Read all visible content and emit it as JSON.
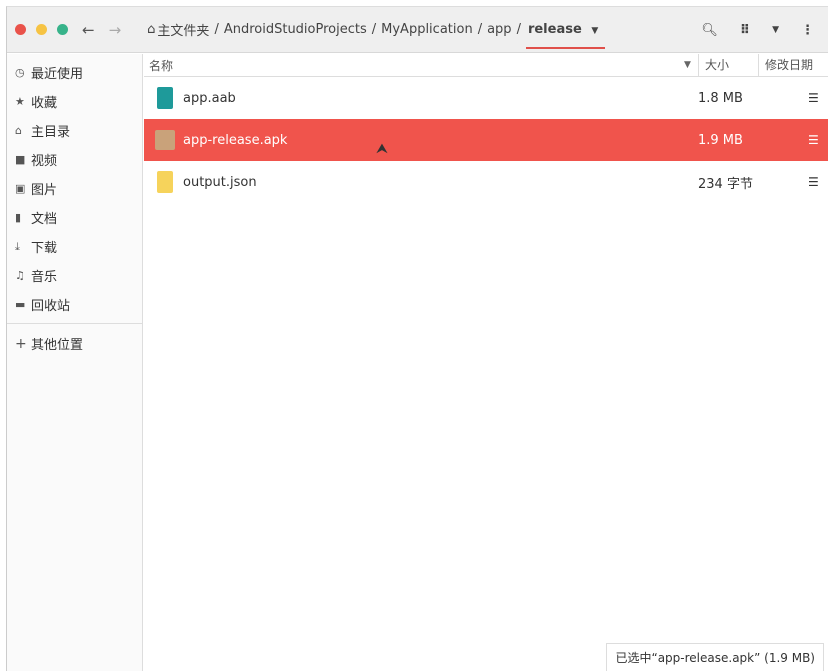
{
  "window": {
    "colors": {
      "close": "#e9524a",
      "minimize": "#f6c343",
      "maximize": "#37b38a",
      "accent": "#f0544c"
    }
  },
  "breadcrumb": {
    "home": "主文件夹",
    "parts": [
      "AndroidStudioProjects",
      "MyApplication",
      "app"
    ],
    "current": "release"
  },
  "sidebar": {
    "items": [
      {
        "icon": "clock-icon",
        "label": "最近使用"
      },
      {
        "icon": "star-icon",
        "label": "收藏"
      },
      {
        "icon": "home-icon",
        "label": "主目录"
      },
      {
        "icon": "video-icon",
        "label": "视频"
      },
      {
        "icon": "image-icon",
        "label": "图片"
      },
      {
        "icon": "document-icon",
        "label": "文档"
      },
      {
        "icon": "download-icon",
        "label": "下载"
      },
      {
        "icon": "music-icon",
        "label": "音乐"
      },
      {
        "icon": "trash-icon",
        "label": "回收站"
      }
    ],
    "other": "其他位置"
  },
  "columns": {
    "name": "名称",
    "size": "大小",
    "modified": "修改日期"
  },
  "files": [
    {
      "name": "app.aab",
      "size": "1.8 MB",
      "icon": "archive-icon",
      "selected": false
    },
    {
      "name": "app-release.apk",
      "size": "1.9 MB",
      "icon": "apk-icon",
      "selected": true
    },
    {
      "name": "output.json",
      "size": "234 字节",
      "icon": "json-file-icon",
      "selected": false
    }
  ],
  "status": "已选中“app-release.apk” (1.9 MB)"
}
